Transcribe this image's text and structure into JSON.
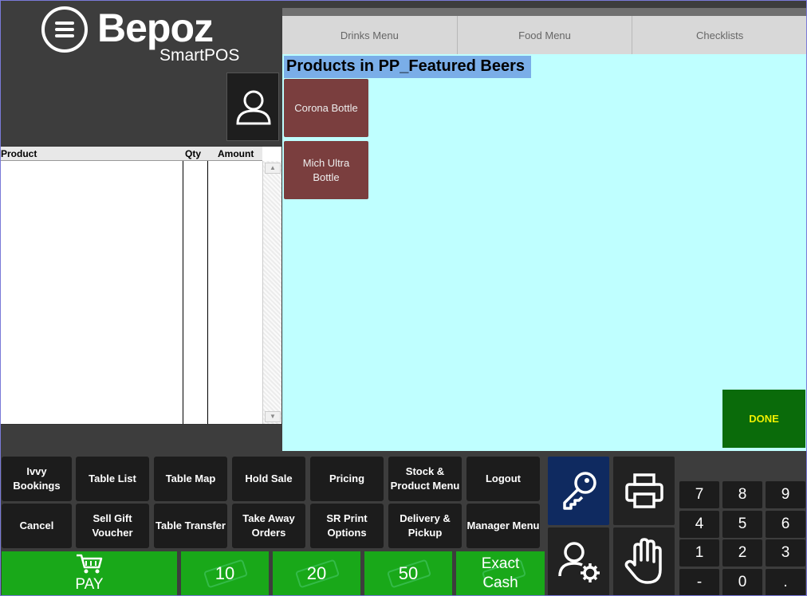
{
  "app": {
    "brand": "Bepoz",
    "brand_sub": "SmartPOS"
  },
  "order_table": {
    "columns": [
      "Product",
      "Qty",
      "Amount"
    ]
  },
  "tabs": [
    "Drinks Menu",
    "Food Menu",
    "Checklists"
  ],
  "section_title": "Products in PP_Featured Beers",
  "products": [
    "Corona Bottle",
    "Mich Ultra Bottle"
  ],
  "done_label": "DONE",
  "functions": [
    "Ivvy Bookings",
    "Table List",
    "Table Map",
    "Hold Sale",
    "Pricing",
    "Stock & Product Menu",
    "Logout",
    "Cancel",
    "Sell Gift Voucher",
    "Table Transfer",
    "Take Away Orders",
    "SR Print Options",
    "Delivery & Pickup",
    "Manager Menu"
  ],
  "keypad": [
    "7",
    "8",
    "9",
    "4",
    "5",
    "6",
    "1",
    "2",
    "3",
    "-",
    "0",
    "."
  ],
  "tender": {
    "pay": "PAY",
    "note_10": "10",
    "note_20": "20",
    "note_50": "50",
    "exact_line1": "Exact",
    "exact_line2": "Cash"
  },
  "icons": {
    "user": "user-icon",
    "key": "key-icon",
    "printer": "printer-icon",
    "user_settings": "user-gear-icon",
    "hand": "hand-icon",
    "cart": "cart-icon"
  },
  "colors": {
    "content_bg": "#bfffff",
    "product_btn": "#7a3e3e",
    "done_bg": "#0a6b0a",
    "pay_green": "#19a819",
    "key_btn": "#0f2a60"
  }
}
